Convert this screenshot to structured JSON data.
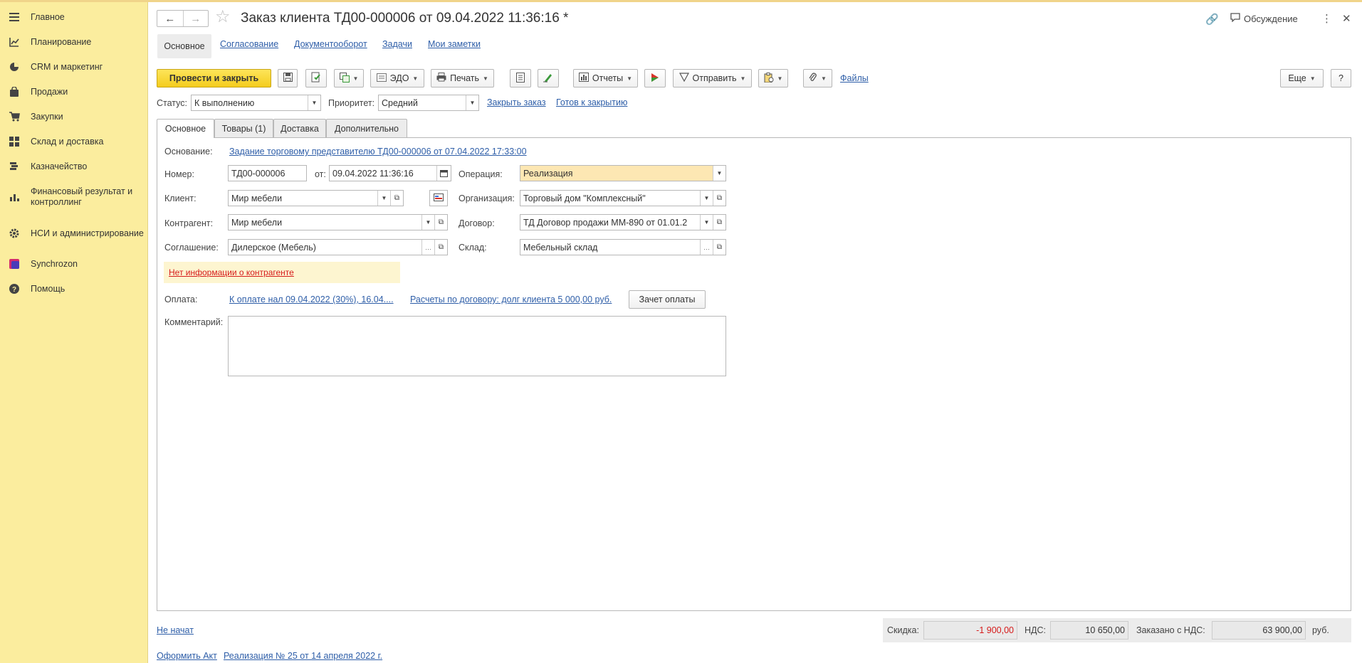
{
  "sidebar": {
    "items": [
      {
        "label": "Главное",
        "icon": "menu-icon"
      },
      {
        "label": "Планирование",
        "icon": "chart-line-icon"
      },
      {
        "label": "CRM и маркетинг",
        "icon": "pie-chart-icon"
      },
      {
        "label": "Продажи",
        "icon": "shopping-bag-icon"
      },
      {
        "label": "Закупки",
        "icon": "cart-icon"
      },
      {
        "label": "Склад и доставка",
        "icon": "warehouse-icon"
      },
      {
        "label": "Казначейство",
        "icon": "coins-icon"
      },
      {
        "label": "Финансовый результат и контроллинг",
        "icon": "bar-chart-icon"
      },
      {
        "label": "НСИ и администрирование",
        "icon": "gear-icon"
      },
      {
        "label": "Synchrozon",
        "icon": "synchrozon-icon"
      },
      {
        "label": "Помощь",
        "icon": "help-icon"
      }
    ]
  },
  "header": {
    "title": "Заказ клиента ТД00-000006 от 09.04.2022 11:36:16 *",
    "discussion": "Обсуждение"
  },
  "section_tabs": [
    "Основное",
    "Согласование",
    "Документооборот",
    "Задачи",
    "Мои заметки"
  ],
  "toolbar": {
    "post_close": "Провести и закрыть",
    "edo": "ЭДО",
    "print": "Печать",
    "reports": "Отчеты",
    "send": "Отправить",
    "files": "Файлы",
    "more": "Еще",
    "help": "?"
  },
  "status_row": {
    "status_label": "Статус:",
    "status_value": "К выполнению",
    "priority_label": "Приоритет:",
    "priority_value": "Средний",
    "close_order": "Закрыть заказ",
    "ready_to_close": "Готов к закрытию"
  },
  "form_tabs": [
    "Основное",
    "Товары (1)",
    "Доставка",
    "Дополнительно"
  ],
  "form": {
    "basis_label": "Основание:",
    "basis_link": "Задание торговому представителю ТД00-000006 от 07.04.2022 17:33:00",
    "number_label": "Номер:",
    "number_value": "ТД00-000006",
    "date_label": "от:",
    "date_value": "09.04.2022 11:36:16",
    "operation_label": "Операция:",
    "operation_value": "Реализация",
    "client_label": "Клиент:",
    "client_value": "Мир мебели",
    "organization_label": "Организация:",
    "organization_value": "Торговый дом \"Комплексный\"",
    "counterparty_label": "Контрагент:",
    "counterparty_value": "Мир мебели",
    "contract_label": "Договор:",
    "contract_value": "ТД Договор продажи ММ-890 от 01.01.2",
    "agreement_label": "Соглашение:",
    "agreement_value": "Дилерское (Мебель)",
    "warehouse_label": "Склад:",
    "warehouse_value": "Мебельный склад",
    "warning": "Нет информации о контрагенте",
    "payment_label": "Оплата:",
    "payment_link1": "К оплате нал 09.04.2022 (30%), 16.04....",
    "payment_link2": "Расчеты по договору: долг клиента 5 000,00 руб.",
    "payment_offset": "Зачет оплаты",
    "comment_label": "Комментарий:"
  },
  "footer": {
    "state_link": "Не начат",
    "act_link": "Оформить Акт",
    "realization_link": "Реализация № 25 от 14 апреля 2022 г.",
    "discount_label": "Скидка:",
    "discount_value": "-1 900,00",
    "vat_label": "НДС:",
    "vat_value": "10 650,00",
    "ordered_label": "Заказано с НДС:",
    "ordered_value": "63 900,00",
    "currency": "руб."
  },
  "colors": {
    "sidebar_bg": "#fbed9e",
    "primary_button": "#f4cc1d",
    "link": "#2e5ea8",
    "warning": "#d61a1a",
    "highlight_field": "#fde7b3"
  }
}
